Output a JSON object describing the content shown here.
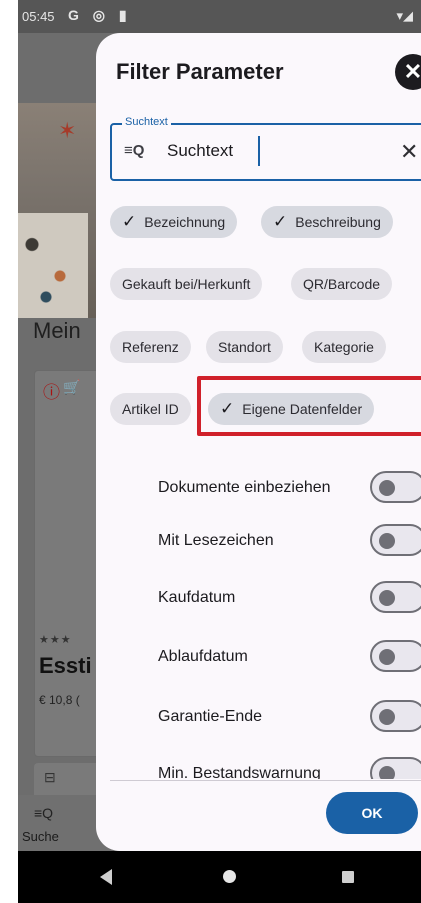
{
  "statusbar": {
    "time": "05:45",
    "icons": "G ◎ ▮",
    "right": "▾◢"
  },
  "background": {
    "heading": "Mein",
    "card_title": "Essti",
    "card_price": "€ 10,8  (",
    "card_stars": "★★★",
    "nav_label": "Suche"
  },
  "dialog": {
    "title": "Filter Parameter",
    "search": {
      "legend": "Suchtext",
      "value": "Suchtext"
    },
    "chips": [
      {
        "label": "Bezeichnung",
        "selected": true
      },
      {
        "label": "Beschreibung",
        "selected": true
      },
      {
        "label": "Gekauft bei/Herkunft",
        "selected": false
      },
      {
        "label": "QR/Barcode",
        "selected": false
      },
      {
        "label": "Referenz",
        "selected": false
      },
      {
        "label": "Standort",
        "selected": false
      },
      {
        "label": "Kategorie",
        "selected": false
      },
      {
        "label": "Artikel ID",
        "selected": false
      },
      {
        "label": "Eigene Datenfelder",
        "selected": true
      }
    ],
    "toggles": [
      {
        "label": "Dokumente einbeziehen",
        "on": false
      },
      {
        "label": "Mit Lesezeichen",
        "on": false
      },
      {
        "label": "Kaufdatum",
        "on": false
      },
      {
        "label": "Ablaufdatum",
        "on": false
      },
      {
        "label": "Garantie-Ende",
        "on": false
      },
      {
        "label": "Min. Bestandswarnung",
        "on": false
      }
    ],
    "ok_label": "OK"
  },
  "colors": {
    "accent": "#1a61a6",
    "highlight": "#d0202a",
    "chip": "#e4e2e8"
  }
}
